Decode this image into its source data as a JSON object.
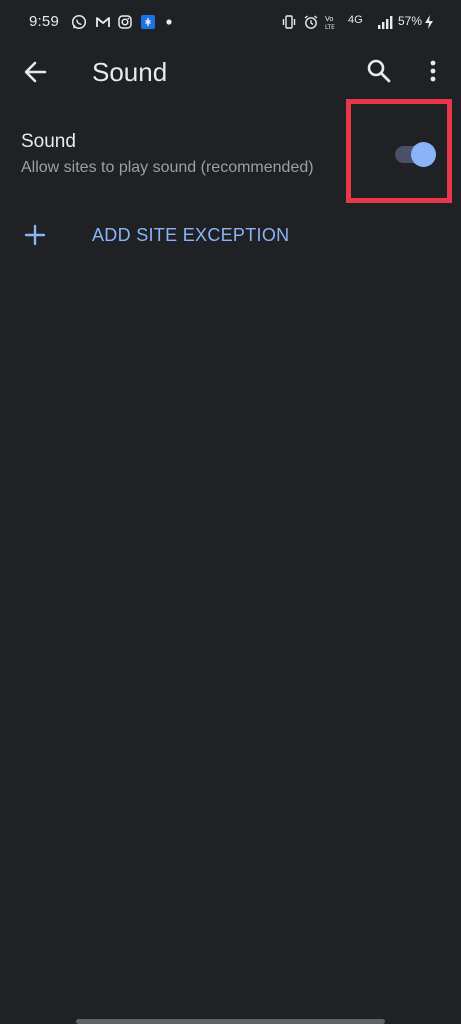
{
  "status_bar": {
    "time": "9:59",
    "network_label": "4G",
    "battery": "57%",
    "icons": [
      "whatsapp-icon",
      "gmail-icon",
      "instagram-icon",
      "app-notification-icon",
      "notification-dot-icon",
      "vibrate-icon",
      "alarm-icon",
      "volte-icon",
      "network-4g-icon",
      "signal-icon",
      "charging-icon"
    ]
  },
  "app_bar": {
    "title": "Sound",
    "icons": [
      "back-arrow-icon",
      "search-icon",
      "more-vert-icon"
    ]
  },
  "setting": {
    "title": "Sound",
    "summary": "Allow sites to play sound (recommended)",
    "toggle_on": true
  },
  "add_exception": {
    "label": "ADD SITE EXCEPTION"
  },
  "colors": {
    "background": "#202124",
    "accent": "#8ab4f8",
    "highlight": "#e8364b"
  }
}
